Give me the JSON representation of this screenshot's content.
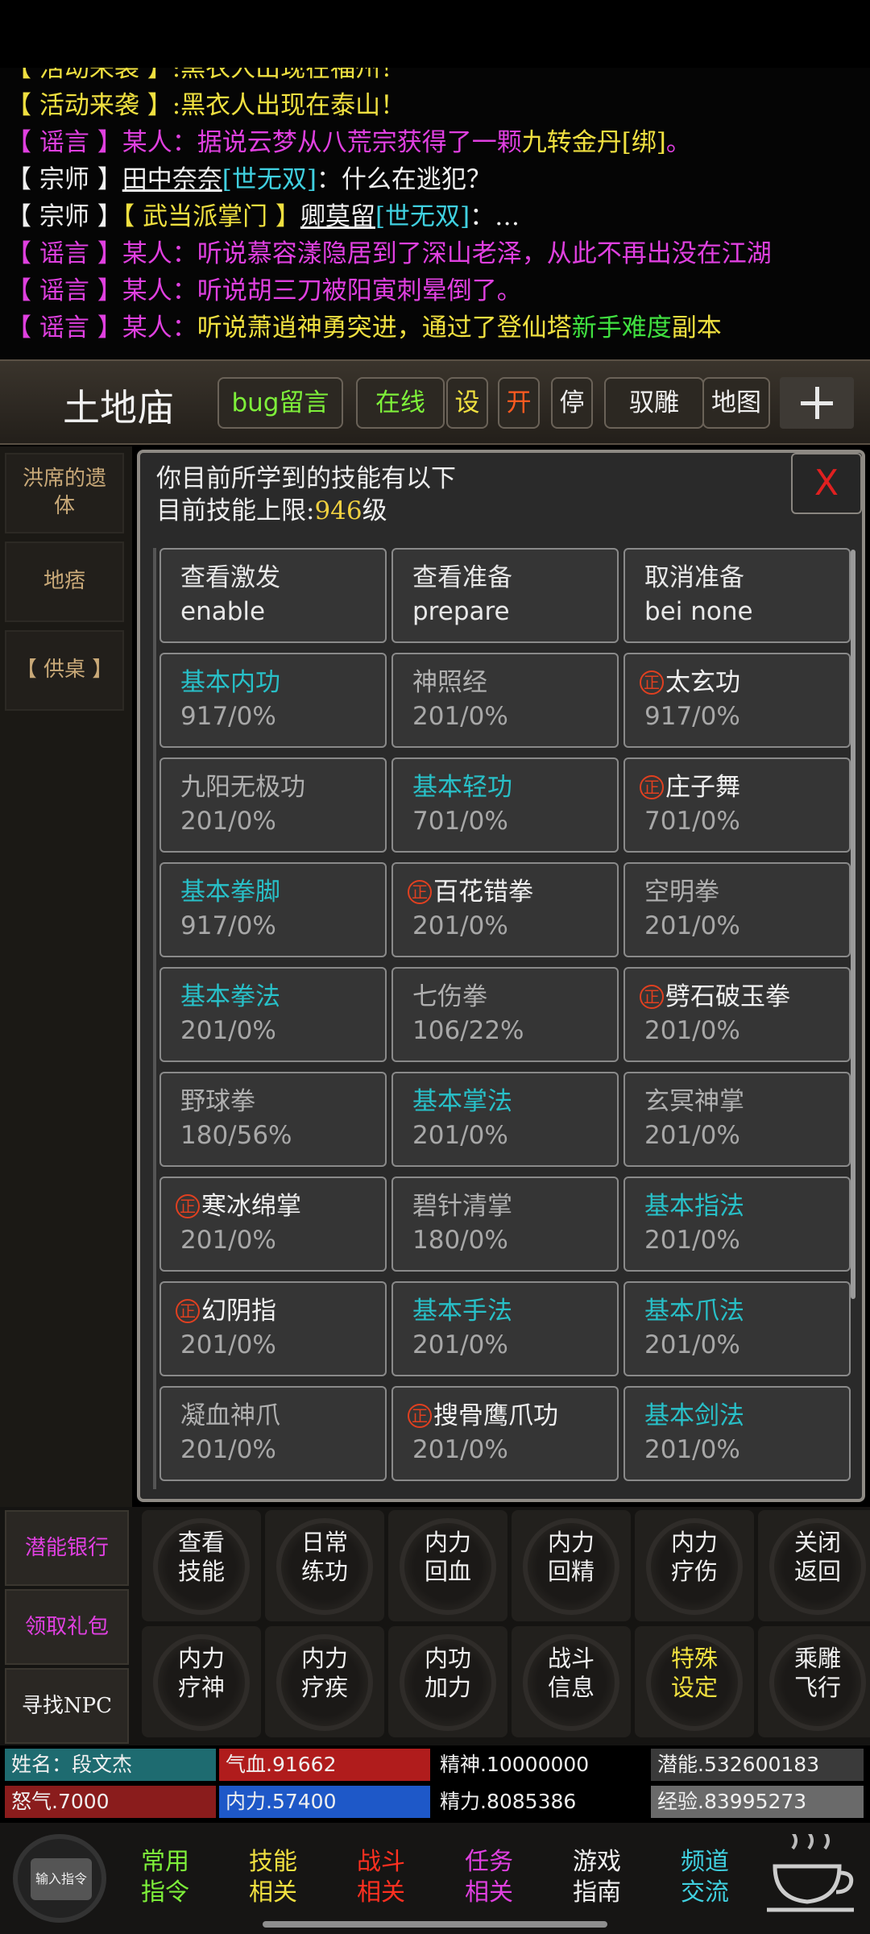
{
  "chat": {
    "lines": [
      {
        "segments": [
          {
            "text": "【 活动来袭 】:黑衣人出现在福州！",
            "color": "#f0e040"
          }
        ]
      },
      {
        "segments": [
          {
            "text": "【 活动来袭 】:黑衣人出现在泰山！",
            "color": "#f0e040"
          }
        ]
      },
      {
        "segments": [
          {
            "text": "【 谣言 】某人：据说云梦从八荒宗获得了一颗",
            "color": "#e040e0"
          },
          {
            "text": "九转金丹[绑]",
            "color": "#f0e040"
          },
          {
            "text": "。",
            "color": "#e040e0"
          }
        ]
      },
      {
        "segments": [
          {
            "text": "【 宗师 】",
            "color": "#f0f0f0"
          },
          {
            "text": "田中奈奈",
            "color": "#f0f0f0",
            "underline": true
          },
          {
            "text": "[世无双]",
            "color": "#40d0e0"
          },
          {
            "text": "：什么在逃犯？",
            "color": "#f0f0f0"
          }
        ]
      },
      {
        "segments": [
          {
            "text": "【 宗师 】",
            "color": "#f0f0f0"
          },
          {
            "text": "【 武当派掌门 】",
            "color": "#f0e040"
          },
          {
            "text": "卿莫留",
            "color": "#f0f0f0",
            "underline": true
          },
          {
            "text": "[世无双]",
            "color": "#40d0e0"
          },
          {
            "text": "：…",
            "color": "#f0f0f0"
          }
        ]
      },
      {
        "segments": [
          {
            "text": "【 谣言 】某人：听说慕容漾隐居到了深山老泽，从此不再出没在江湖",
            "color": "#e040e0"
          }
        ]
      },
      {
        "segments": [
          {
            "text": "【 谣言 】某人：听说胡三刀被阳寅刺晕倒了。",
            "color": "#e040e0"
          }
        ]
      },
      {
        "segments": [
          {
            "text": "【 谣言 】某人：",
            "color": "#e040e0"
          },
          {
            "text": "听说萧逍神勇突进，通过了登仙塔",
            "color": "#f0e040"
          },
          {
            "text": "新手难度",
            "color": "#40e040"
          },
          {
            "text": "副本",
            "color": "#f0e040"
          }
        ]
      }
    ]
  },
  "header": {
    "location": "土地庙",
    "buttons": [
      {
        "label": "bug留言",
        "color": "#7ef03a",
        "name": "bug-report-button"
      },
      {
        "label": "在线",
        "color": "#7ef03a",
        "name": "online-button"
      },
      {
        "label": "设",
        "color": "#f0e040",
        "name": "settings-button"
      },
      {
        "label": "开",
        "color": "#ff5a20",
        "name": "open-button"
      },
      {
        "label": "停",
        "color": "#f0f0f0",
        "name": "stop-button"
      },
      {
        "label": "驭雕",
        "color": "#f0f0f0",
        "name": "ride-eagle-button"
      },
      {
        "label": "地图",
        "color": "#f0f0f0",
        "name": "map-button"
      }
    ]
  },
  "sidebar": {
    "items": [
      "洪席的遗体",
      "地痞",
      "【 供桌 】"
    ]
  },
  "skills_panel": {
    "title": "你目前所学到的技能有以下",
    "limit_label": "目前技能上限:",
    "limit_value": "946",
    "limit_unit": "级",
    "close_label": "X",
    "commands": [
      {
        "line1": "查看激发",
        "line2": "enable"
      },
      {
        "line1": "查看准备",
        "line2": "prepare"
      },
      {
        "line1": "取消准备",
        "line2": "bei none"
      }
    ],
    "skills": [
      {
        "name": "基本内功",
        "level": "917/0%",
        "type": "basic",
        "zheng": false
      },
      {
        "name": "神照经",
        "level": "201/0%",
        "type": "normal",
        "zheng": false
      },
      {
        "name": "太玄功",
        "level": "917/0%",
        "type": "special",
        "zheng": true
      },
      {
        "name": "九阳无极功",
        "level": "201/0%",
        "type": "normal",
        "zheng": false
      },
      {
        "name": "基本轻功",
        "level": "701/0%",
        "type": "basic",
        "zheng": false
      },
      {
        "name": "庄子舞",
        "level": "701/0%",
        "type": "special",
        "zheng": true
      },
      {
        "name": "基本拳脚",
        "level": "917/0%",
        "type": "basic",
        "zheng": false
      },
      {
        "name": "百花错拳",
        "level": "201/0%",
        "type": "special",
        "zheng": true
      },
      {
        "name": "空明拳",
        "level": "201/0%",
        "type": "normal",
        "zheng": false
      },
      {
        "name": "基本拳法",
        "level": "201/0%",
        "type": "basic",
        "zheng": false
      },
      {
        "name": "七伤拳",
        "level": "106/22%",
        "type": "normal",
        "zheng": false
      },
      {
        "name": "劈石破玉拳",
        "level": "201/0%",
        "type": "special",
        "zheng": true
      },
      {
        "name": "野球拳",
        "level": "180/56%",
        "type": "normal",
        "zheng": false
      },
      {
        "name": "基本掌法",
        "level": "201/0%",
        "type": "basic",
        "zheng": false
      },
      {
        "name": "玄冥神掌",
        "level": "201/0%",
        "type": "normal",
        "zheng": false
      },
      {
        "name": "寒冰绵掌",
        "level": "201/0%",
        "type": "special",
        "zheng": true
      },
      {
        "name": "碧针清掌",
        "level": "180/0%",
        "type": "normal",
        "zheng": false
      },
      {
        "name": "基本指法",
        "level": "201/0%",
        "type": "basic",
        "zheng": false
      },
      {
        "name": "幻阴指",
        "level": "201/0%",
        "type": "special",
        "zheng": true
      },
      {
        "name": "基本手法",
        "level": "201/0%",
        "type": "basic",
        "zheng": false
      },
      {
        "name": "基本爪法",
        "level": "201/0%",
        "type": "basic",
        "zheng": false
      },
      {
        "name": "凝血神爪",
        "level": "201/0%",
        "type": "normal",
        "zheng": false
      },
      {
        "name": "搜骨鹰爪功",
        "level": "201/0%",
        "type": "special",
        "zheng": true
      },
      {
        "name": "基本剑法",
        "level": "201/0%",
        "type": "basic",
        "zheng": false
      }
    ],
    "zheng_mark": "正"
  },
  "side_actions": [
    {
      "label": "潜能银行",
      "color": "#e040e0"
    },
    {
      "label": "领取礼包",
      "color": "#e040e0"
    },
    {
      "label": "寻找NPC",
      "color": "#f0f0f0"
    }
  ],
  "action_grid": [
    {
      "line1": "查看",
      "line2": "技能",
      "color": "#f0f0f0"
    },
    {
      "line1": "日常",
      "line2": "练功",
      "color": "#f0f0f0"
    },
    {
      "line1": "内力",
      "line2": "回血",
      "color": "#f0f0f0"
    },
    {
      "line1": "内力",
      "line2": "回精",
      "color": "#f0f0f0"
    },
    {
      "line1": "内力",
      "line2": "疗伤",
      "color": "#f0f0f0"
    },
    {
      "line1": "关闭",
      "line2": "返回",
      "color": "#f0f0f0"
    },
    {
      "line1": "内力",
      "line2": "疗神",
      "color": "#f0f0f0"
    },
    {
      "line1": "内力",
      "line2": "疗疾",
      "color": "#f0f0f0"
    },
    {
      "line1": "内功",
      "line2": "加力",
      "color": "#f0f0f0"
    },
    {
      "line1": "战斗",
      "line2": "信息",
      "color": "#f0f0f0"
    },
    {
      "line1": "特殊",
      "line2": "设定",
      "color": "#f0e040"
    },
    {
      "line1": "乘雕",
      "line2": "飞行",
      "color": "#f0f0f0"
    }
  ],
  "stats": [
    {
      "label": "姓名：段文杰",
      "bg": "#1e6b70"
    },
    {
      "label": "气血.91662",
      "bg": "#b01c1c"
    },
    {
      "label": "精神.10000000",
      "bg": "#000000"
    },
    {
      "label": "潜能.532600183",
      "bg": "#3a3a3a"
    },
    {
      "label": "怒气.7000",
      "bg": "#8a1c1c"
    },
    {
      "label": "内力.57400",
      "bg": "#1e58c8"
    },
    {
      "label": "精力.8085386",
      "bg": "#000000"
    },
    {
      "label": "经验.83995273",
      "bg": "#6a6a6a"
    }
  ],
  "bottom_nav": {
    "input_label": "输入指令",
    "buttons": [
      {
        "line1": "常用",
        "line2": "指令",
        "color": "#7ef03a"
      },
      {
        "line1": "技能",
        "line2": "相关",
        "color": "#f0e040"
      },
      {
        "line1": "战斗",
        "line2": "相关",
        "color": "#ff3020"
      },
      {
        "line1": "任务",
        "line2": "相关",
        "color": "#e040e0"
      },
      {
        "line1": "游戏",
        "line2": "指南",
        "color": "#f0f0f0"
      },
      {
        "line1": "频道",
        "line2": "交流",
        "color": "#40d0e0"
      }
    ]
  },
  "colors": {
    "basic_skill": "#28c0c8",
    "special_skill": "#f0f0f0",
    "normal_skill": "#b0b0b0",
    "zheng_mark": "#e04020"
  }
}
